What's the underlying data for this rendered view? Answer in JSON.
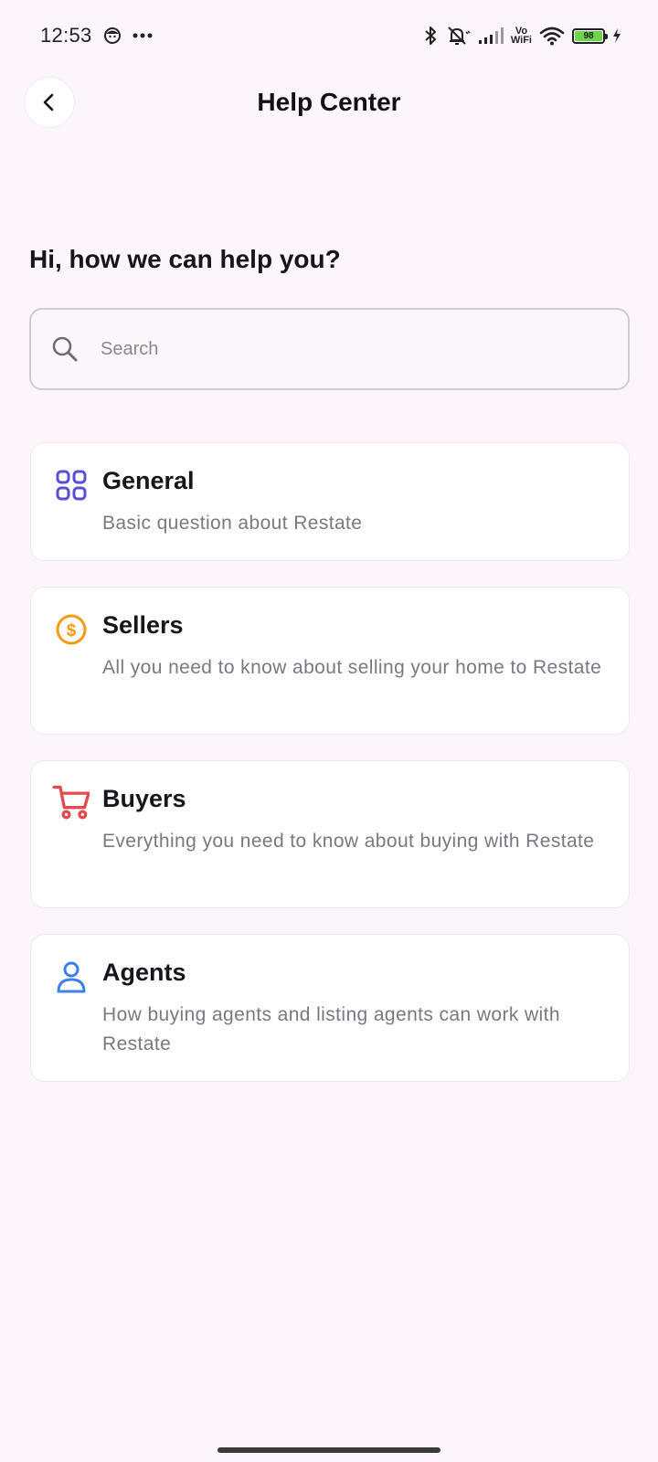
{
  "status_bar": {
    "time": "12:53",
    "notification_icons": [
      "face-icon",
      "more-dots-icon"
    ],
    "system_icons": [
      "bluetooth-icon",
      "silent-icon",
      "signal-icon",
      "vowifi-icon",
      "wifi-icon",
      "battery-icon",
      "charging-icon"
    ],
    "vowifi_line1": "Vo",
    "vowifi_line2": "WiFi",
    "battery_level": "98",
    "battery_color": "#6bd64a"
  },
  "header": {
    "back_icon": "chevron-left-icon",
    "title": "Help Center"
  },
  "greeting": "Hi, how we can help you?",
  "search": {
    "icon": "search-icon",
    "placeholder": "Search",
    "value": ""
  },
  "categories": [
    {
      "icon": "grid-icon",
      "icon_color": "#5b4fd6",
      "title": "General",
      "description": "Basic question about Restate"
    },
    {
      "icon": "dollar-circle-icon",
      "icon_color": "#f39c12",
      "title": "Sellers",
      "description": "All you need to know about selling your home to Restate"
    },
    {
      "icon": "cart-icon",
      "icon_color": "#e5484d",
      "title": "Buyers",
      "description": "Everything you need to know about buying with Restate"
    },
    {
      "icon": "person-icon",
      "icon_color": "#3d7ff0",
      "title": "Agents",
      "description": "How buying agents and listing agents can work with Restate"
    }
  ]
}
